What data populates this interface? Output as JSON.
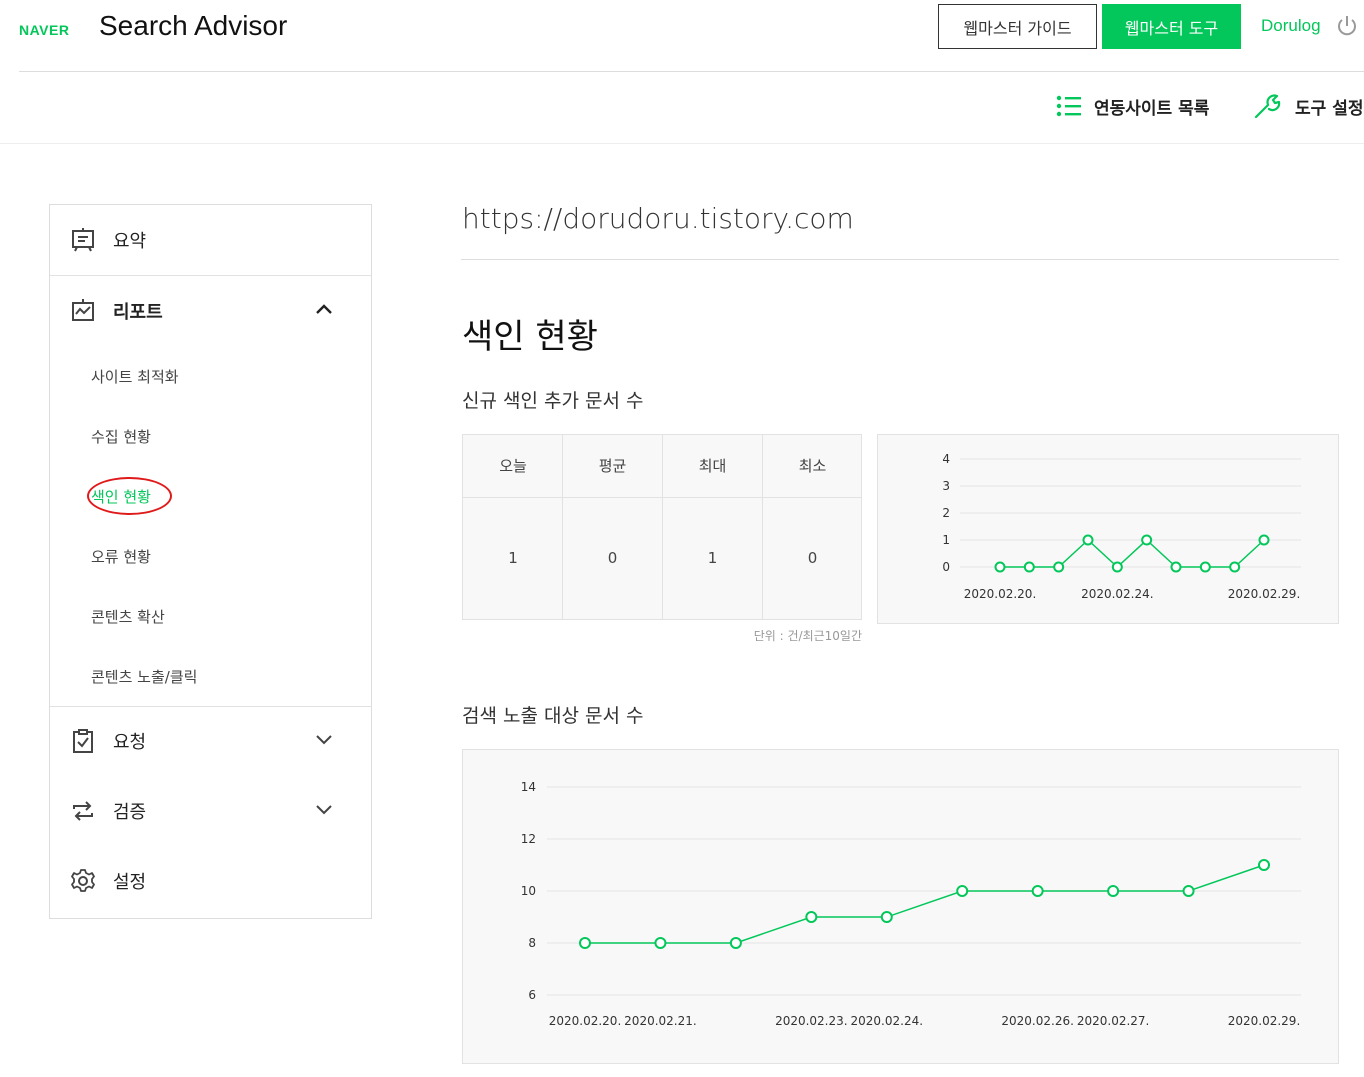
{
  "header": {
    "logo": "NAVER",
    "title": "Search Advisor",
    "guide_button": "웹마스터 가이드",
    "tool_button": "웹마스터 도구",
    "user": "Dorulog"
  },
  "subnav": {
    "sites_label": "연동사이트 목록",
    "settings_label": "도구 설정"
  },
  "sidebar": {
    "summary": "요약",
    "report": "리포트",
    "report_items": [
      "사이트 최적화",
      "수집 현황",
      "색인 현황",
      "오류 현황",
      "콘텐츠 확산",
      "콘텐츠 노출/클릭"
    ],
    "request": "요청",
    "verify": "검증",
    "settings": "설정"
  },
  "main": {
    "site_url": "https://dorudoru.tistory.com",
    "section_title": "색인 현황",
    "new_docs_title": "신규 색인 추가 문서 수",
    "stats_headers": [
      "오늘",
      "평균",
      "최대",
      "최소"
    ],
    "stats_values": [
      "1",
      "0",
      "1",
      "0"
    ],
    "unit_note": "단위 : 건/최근10일간",
    "exposed_docs_title": "검색 노출 대상 문서 수"
  },
  "colors": {
    "accent": "#03c75a",
    "highlight_circle": "#e01a1a"
  },
  "chart_data": [
    {
      "type": "line",
      "x": [
        "2020.02.20.",
        "2020.02.21.",
        "2020.02.22.",
        "2020.02.23.",
        "2020.02.24.",
        "2020.02.25.",
        "2020.02.26.",
        "2020.02.27.",
        "2020.02.28.",
        "2020.02.29."
      ],
      "x_tick_labels": [
        "2020.02.20.",
        "2020.02.24.",
        "2020.02.29."
      ],
      "series": [
        {
          "values": [
            0,
            0,
            0,
            1,
            0,
            1,
            0,
            0,
            0,
            1
          ]
        }
      ],
      "yticks": [
        0,
        1,
        2,
        3,
        4
      ],
      "ylim": [
        0,
        4
      ],
      "grid": true,
      "color": "#03c75a"
    },
    {
      "type": "line",
      "x": [
        "2020.02.20.",
        "2020.02.21.",
        "2020.02.22.",
        "2020.02.23.",
        "2020.02.24.",
        "2020.02.25.",
        "2020.02.26.",
        "2020.02.27.",
        "2020.02.28.",
        "2020.02.29."
      ],
      "x_tick_labels": [
        "2020.02.20.",
        "2020.02.21.",
        "2020.02.23.",
        "2020.02.24.",
        "2020.02.26.",
        "2020.02.27.",
        "2020.02.29."
      ],
      "series": [
        {
          "values": [
            8,
            8,
            8,
            9,
            9,
            10,
            10,
            10,
            10,
            11
          ]
        }
      ],
      "yticks": [
        6,
        8,
        10,
        12,
        14
      ],
      "ylim": [
        6,
        14
      ],
      "grid": true,
      "color": "#03c75a"
    }
  ]
}
